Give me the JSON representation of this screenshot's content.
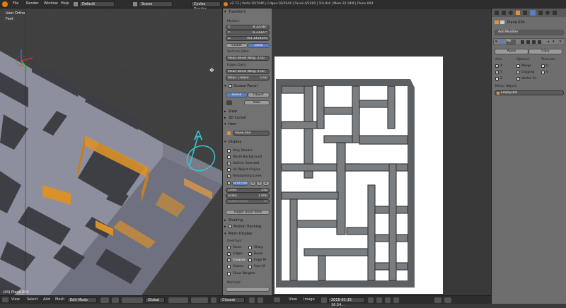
{
  "topbar": {
    "menus": [
      "File",
      "Render",
      "Window",
      "Help"
    ],
    "layout": "Default",
    "scene": "Scene",
    "engine": "Cycles Render",
    "stats": "v2.73 | Verts:30/1946 | Edges:18/2944 | Faces:4/2200 | Tris:4/4 | Mem:22.94M | Plane.004"
  },
  "viewport": {
    "view_name": "User Ortho",
    "units": "Feet",
    "object_label": "(44) Plane.004",
    "annotation": "A"
  },
  "npanel": {
    "transform_title": "Transform",
    "median_label": "Median:",
    "x_label": "X:",
    "x_value": "8.32184\"",
    "y_label": "Y:",
    "y_value": "6.33327\"",
    "z_label": "Z:",
    "z_value": "781.14583mi",
    "global": "Global",
    "local": "Local",
    "vertices_data": "Vertices Data:",
    "mean_bevel_weight_v": "Mean Bevel Weig: 0.00",
    "edges_data": "Edges Data:",
    "mean_bevel_weight_e": "Mean Bevel Weig: 0.00",
    "mean_crease": "Mean Crease:",
    "mean_crease_value": "0.00",
    "grease_pencil": "Grease Pencil",
    "gp_scene": "Scene",
    "gp_object": "Object",
    "gp_new": "New",
    "view": "View",
    "cursor_3d": "3D Cursor",
    "item": "Item",
    "item_name": "Plane.004",
    "display": "Display",
    "only_render": "Only Render",
    "world_background": "World Background",
    "outline_selected": "Outline Selected",
    "all_object_origins": "All Object Origins",
    "relationship_lines": "Relationship Lines",
    "grid_floor": "Grid Floo",
    "grid_x": "X",
    "grid_y": "Y",
    "grid_z": "Z",
    "lines": "Lines:",
    "lines_value": "250",
    "scale": "Scale:",
    "scale_value": "1.000",
    "subdivisions": "Subdivisions:",
    "subdivisions_value": "10",
    "toggle_quad_view": "Toggle Quad View",
    "shading": "Shading",
    "motion_tracking": "Motion Tracking",
    "mesh_display": "Mesh Display",
    "overlays": "Overlays:",
    "faces": "Faces",
    "sharp": "Sharp",
    "edges": "Edges",
    "bevel": "Bevel",
    "creases": "Creases",
    "edge_m": "Edge M",
    "seams": "Seams",
    "face_m": "Face M",
    "show_weights": "Show Weights",
    "normals": "Normals:"
  },
  "imagebar": {
    "view": "View",
    "image": "Image",
    "image_name": "2015-01-15 16.54...",
    "zoom": ""
  },
  "bottombar": {
    "view": "View",
    "select": "Select",
    "add": "Add",
    "mesh": "Mesh",
    "mode": "Edit Mode",
    "orientation": "Global",
    "snap": "Closest"
  },
  "props": {
    "object_name": "Plane.004",
    "add_modifier": "Add Modifier",
    "mod_name": "Mir",
    "apply": "Apply",
    "copy": "Copy",
    "axis": "Axis:",
    "options": "Options:",
    "textures": "Textures:",
    "ax_x": "X",
    "ax_y": "Y",
    "ax_z": "Z",
    "merge": "Merge",
    "clipping": "Clipping",
    "vertex_gr": "Vertex Gr",
    "tex_u": "U",
    "tex_v": "V",
    "mirror_object": "Mirror Object:",
    "mirror_target": "Empty.001"
  },
  "colors": {
    "accent_blue": "#5680c2",
    "selection_orange": "#e8a040",
    "mesh_face": "#8d8f9f"
  }
}
